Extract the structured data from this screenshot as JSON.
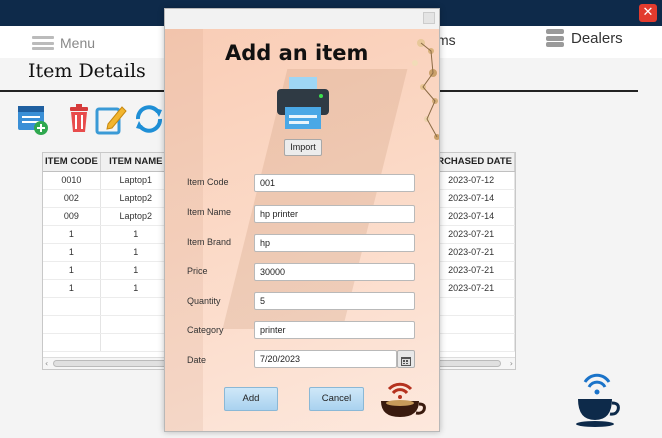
{
  "window": {
    "close_label": "✕"
  },
  "navbar": {
    "menu_label": "Menu",
    "partial_item": "ms",
    "dealers_label": "Dealers"
  },
  "page": {
    "title": "Item Details"
  },
  "table": {
    "headers": [
      "ITEM CODE",
      "ITEM NAME",
      "URCHASED DATE"
    ],
    "rows": [
      [
        "0010",
        "Laptop1",
        "2023-07-12"
      ],
      [
        "002",
        "Laptop2",
        "2023-07-14"
      ],
      [
        "009",
        "Laptop2",
        "2023-07-14"
      ],
      [
        "1",
        "1",
        "2023-07-21"
      ],
      [
        "1",
        "1",
        "2023-07-21"
      ],
      [
        "1",
        "1",
        "2023-07-21"
      ],
      [
        "1",
        "1",
        "2023-07-21"
      ],
      [
        "",
        "",
        ""
      ],
      [
        "",
        "",
        ""
      ],
      [
        "",
        "",
        ""
      ]
    ]
  },
  "dialog": {
    "title": "Add an item",
    "import_label": "Import",
    "fields": {
      "item_code": {
        "label": "Item Code",
        "value": "001"
      },
      "item_name": {
        "label": "Item Name",
        "value": "hp printer"
      },
      "item_brand": {
        "label": "Item Brand",
        "value": "hp"
      },
      "price": {
        "label": "Price",
        "value": "30000"
      },
      "quantity": {
        "label": "Quantity",
        "value": "5"
      },
      "category": {
        "label": "Category",
        "value": "printer"
      },
      "date": {
        "label": "Date",
        "value": "7/20/2023"
      }
    },
    "add_label": "Add",
    "cancel_label": "Cancel"
  },
  "colors": {
    "topbar": "#0e2a4a",
    "close": "#e23b2e",
    "dialog_bg": "#fbd9c6",
    "button": "#a9d2ef"
  },
  "icons": [
    "hamburger-icon",
    "database-icon",
    "add-item-icon",
    "delete-icon",
    "edit-icon",
    "refresh-icon",
    "printer-icon",
    "coffee-cup-icon",
    "calendar-icon"
  ]
}
